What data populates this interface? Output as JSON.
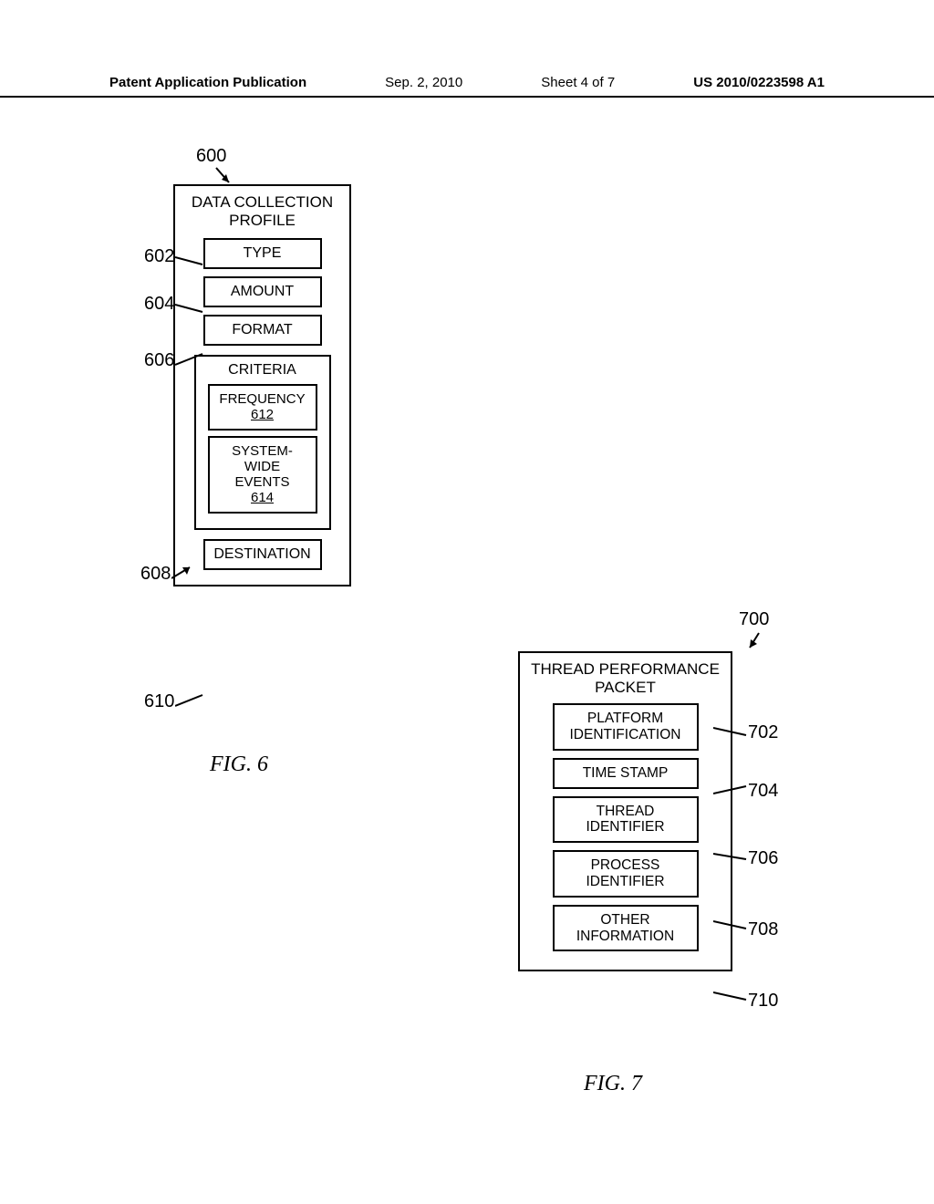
{
  "header": {
    "pub": "Patent Application Publication",
    "date": "Sep. 2, 2010",
    "sheet": "Sheet 4 of 7",
    "pubno": "US 2010/0223598 A1"
  },
  "fig6": {
    "ref": "600",
    "title_l1": "DATA COLLECTION",
    "title_l2": "PROFILE",
    "items": {
      "type": {
        "ref": "602",
        "label": "TYPE"
      },
      "amount": {
        "ref": "604",
        "label": "AMOUNT"
      },
      "format": {
        "ref": "606",
        "label": "FORMAT"
      },
      "criteria": {
        "ref": "608",
        "label": "CRITERIA",
        "frequency": {
          "ref": "612",
          "label": "FREQUENCY"
        },
        "events": {
          "ref": "614",
          "label_l1": "SYSTEM-",
          "label_l2": "WIDE",
          "label_l3": "EVENTS"
        }
      },
      "destination": {
        "ref": "610",
        "label": "DESTINATION"
      }
    },
    "caption": "FIG. 6"
  },
  "fig7": {
    "ref": "700",
    "title_l1": "THREAD PERFORMANCE",
    "title_l2": "PACKET",
    "items": {
      "platform": {
        "ref": "702",
        "label_l1": "PLATFORM",
        "label_l2": "IDENTIFICATION"
      },
      "timestamp": {
        "ref": "704",
        "label": "TIME STAMP"
      },
      "thread": {
        "ref": "706",
        "label_l1": "THREAD",
        "label_l2": "IDENTIFIER"
      },
      "process": {
        "ref": "708",
        "label_l1": "PROCESS",
        "label_l2": "IDENTIFIER"
      },
      "other": {
        "ref": "710",
        "label_l1": "OTHER",
        "label_l2": "INFORMATION"
      }
    },
    "caption": "FIG. 7"
  }
}
